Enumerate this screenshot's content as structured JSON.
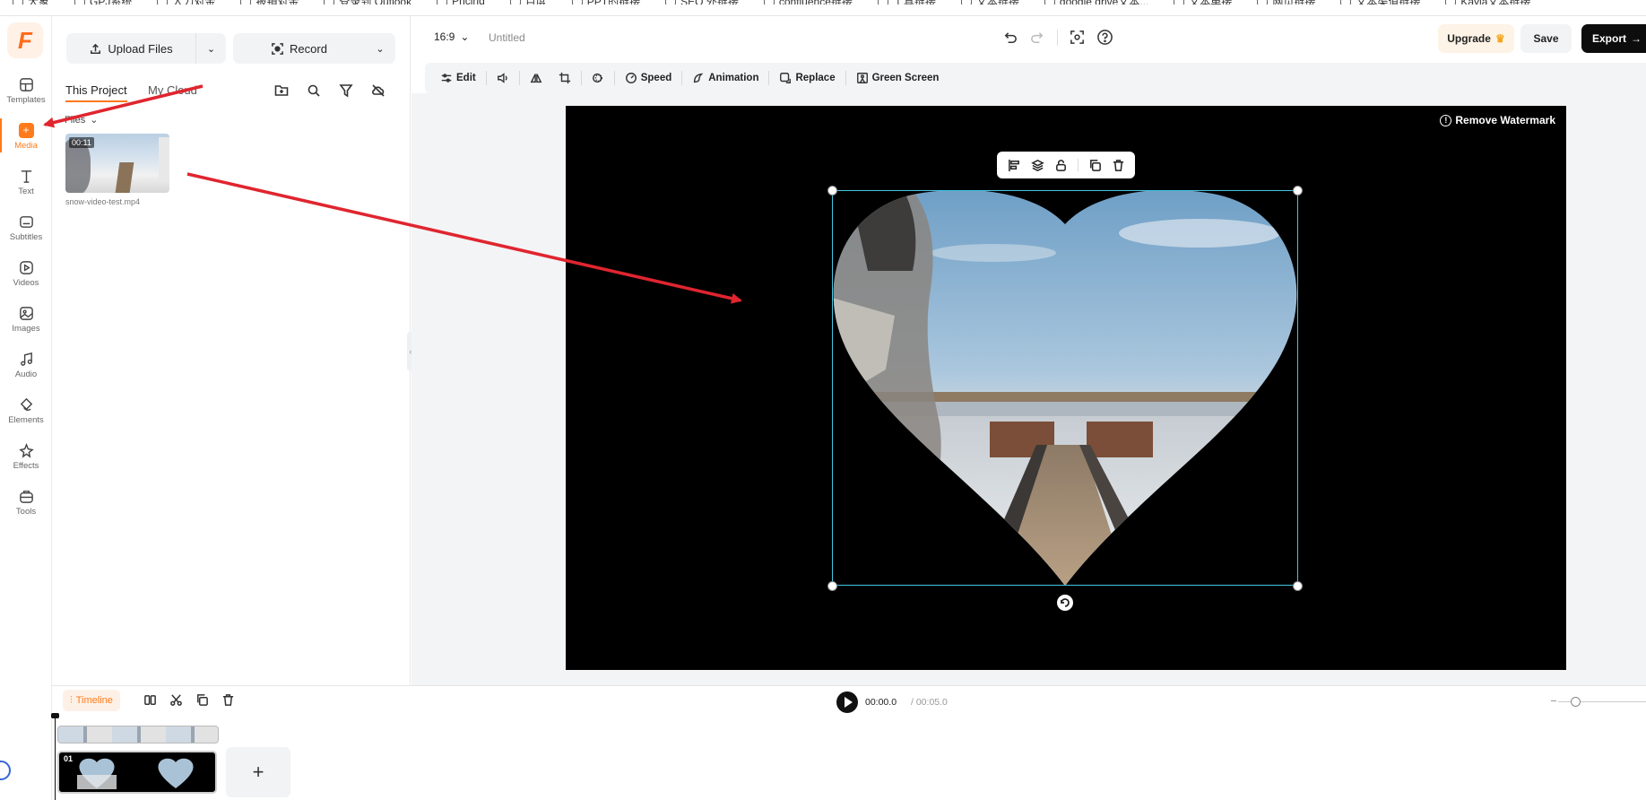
{
  "bookmarks": [
    "大象",
    "GPJ系统",
    "人力对金",
    "报销对金",
    "登录到 Outlook",
    "Pricing",
    "百度",
    "PPT的链接",
    "SEO 外链接",
    "confluence链接",
    "工具链接",
    "文本链接",
    "google drive文本...",
    "文本单接",
    "网页链接",
    "文本渠道链接",
    "Kayla文本链接"
  ],
  "brand": {
    "logo_letter": "F",
    "accent": "#ff7a1a"
  },
  "rail": {
    "items": [
      {
        "label": "Templates",
        "icon": "templates-icon"
      },
      {
        "label": "Media",
        "icon": "media-icon"
      },
      {
        "label": "Text",
        "icon": "text-icon"
      },
      {
        "label": "Subtitles",
        "icon": "subtitles-icon"
      },
      {
        "label": "Videos",
        "icon": "videos-icon"
      },
      {
        "label": "Images",
        "icon": "images-icon"
      },
      {
        "label": "Audio",
        "icon": "audio-icon"
      },
      {
        "label": "Elements",
        "icon": "elements-icon"
      },
      {
        "label": "Effects",
        "icon": "effects-icon"
      },
      {
        "label": "Tools",
        "icon": "tools-icon"
      }
    ],
    "active": "Media"
  },
  "panel": {
    "upload_label": "Upload Files",
    "record_label": "Record",
    "tabs": [
      "This Project",
      "My Cloud"
    ],
    "active_tab": "This Project",
    "files_label": "Files",
    "file": {
      "name": "snow-video-test.mp4",
      "duration": "00:11"
    }
  },
  "topbar": {
    "ratio": "16:9",
    "title": "Untitled",
    "upgrade": "Upgrade",
    "upgrade_icon": "crown-icon",
    "save": "Save",
    "export": "Export"
  },
  "edit_bar": {
    "edit": "Edit",
    "speed": "Speed",
    "animation": "Animation",
    "replace": "Replace",
    "green_screen": "Green Screen"
  },
  "canvas": {
    "watermark": "Remove Watermark",
    "background": "#000000",
    "selection_color": "#45c6e0"
  },
  "timeline": {
    "label": "Timeline",
    "current_time": "00:00.0",
    "separator": "/",
    "total_time": "00:05.0",
    "clip_number": "01"
  }
}
